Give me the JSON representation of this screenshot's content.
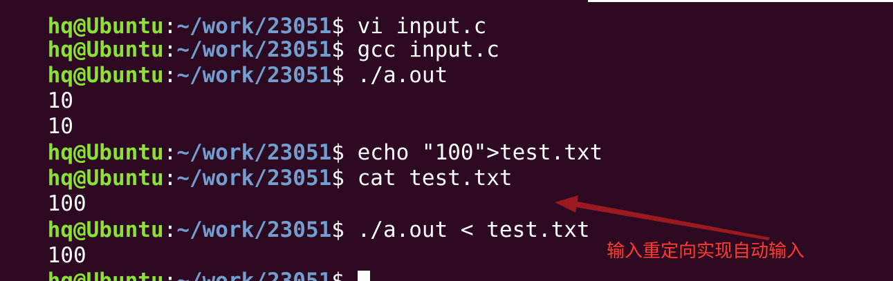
{
  "terminal": {
    "colors": {
      "background": "#2d0a22",
      "user": "#8ae234",
      "path": "#729fcf",
      "text": "#ffffff",
      "annotation": "#ff3b30"
    },
    "lines": [
      {
        "kind": "prompt",
        "user": "hq@Ubuntu",
        "colon": ":",
        "path": "~/work/23051",
        "dollar": "$",
        "command": " vi input.c"
      },
      {
        "kind": "prompt",
        "user": "hq@Ubuntu",
        "colon": ":",
        "path": "~/work/23051",
        "dollar": "$",
        "command": " gcc input.c"
      },
      {
        "kind": "prompt",
        "user": "hq@Ubuntu",
        "colon": ":",
        "path": "~/work/23051",
        "dollar": "$",
        "command": " ./a.out"
      },
      {
        "kind": "output",
        "text": "10"
      },
      {
        "kind": "output",
        "text": "10"
      },
      {
        "kind": "prompt",
        "user": "hq@Ubuntu",
        "colon": ":",
        "path": "~/work/23051",
        "dollar": "$",
        "command": " echo \"100\">test.txt"
      },
      {
        "kind": "prompt",
        "user": "hq@Ubuntu",
        "colon": ":",
        "path": "~/work/23051",
        "dollar": "$",
        "command": " cat test.txt"
      },
      {
        "kind": "output",
        "text": "100"
      },
      {
        "kind": "prompt",
        "user": "hq@Ubuntu",
        "colon": ":",
        "path": "~/work/23051",
        "dollar": "$",
        "command": " ./a.out < test.txt"
      },
      {
        "kind": "output",
        "text": "100"
      },
      {
        "kind": "prompt",
        "user": "hq@Ubuntu",
        "colon": ":",
        "path": "~/work/23051",
        "dollar": "$",
        "command": " "
      }
    ]
  },
  "annotation": {
    "text": "输入重定向实现自动输入",
    "arrow_icon": "arrow-left-icon"
  }
}
